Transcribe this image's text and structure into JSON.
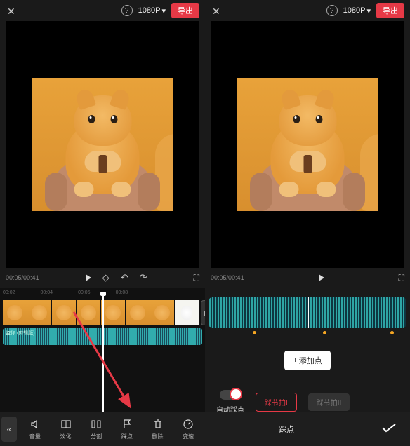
{
  "topbar": {
    "resolution": "1080P",
    "export_label": "导出"
  },
  "playbar": {
    "current_time": "00:05",
    "total_time": "00:41"
  },
  "ruler": {
    "marks": [
      "00:02",
      "00:04",
      "00:06",
      "00:08"
    ]
  },
  "audio_track": {
    "label": "盗你 (剪辑版)"
  },
  "toolbar": {
    "items": [
      {
        "name": "volume",
        "label": "音量"
      },
      {
        "name": "fade",
        "label": "淡化"
      },
      {
        "name": "split",
        "label": "分割"
      },
      {
        "name": "beat",
        "label": "踩点"
      },
      {
        "name": "delete",
        "label": "删除"
      },
      {
        "name": "speed",
        "label": "变速"
      }
    ]
  },
  "beat_panel": {
    "add_point_label": "添加点",
    "auto_beat_label": "自动踩点",
    "mode1_label": "踩节拍I",
    "mode2_label": "踩节拍II",
    "bottom_label": "踩点"
  },
  "colors": {
    "accent": "#e63946",
    "waveform": "#3dd6d0"
  }
}
